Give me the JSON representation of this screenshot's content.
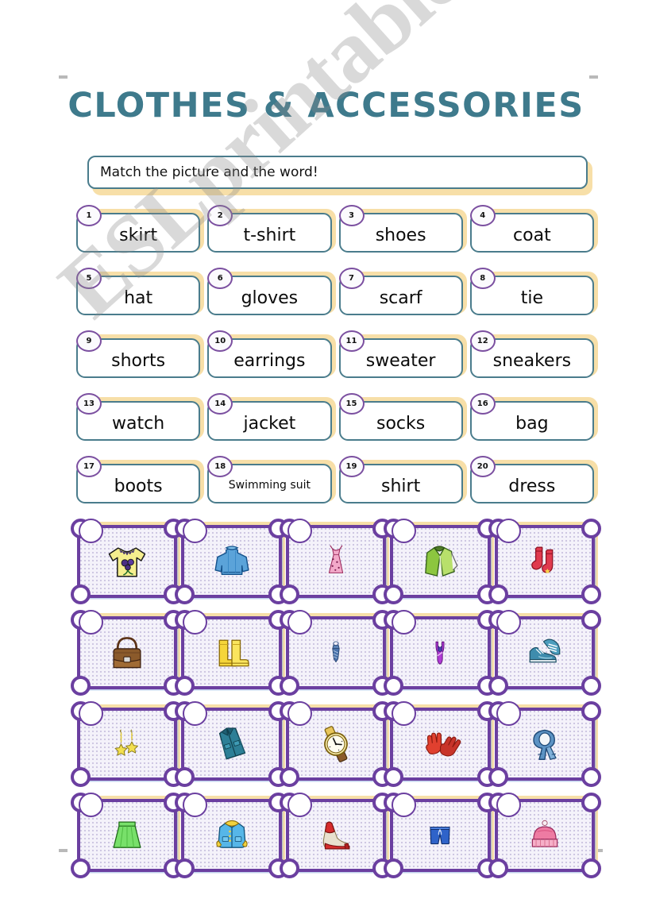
{
  "worksheet": {
    "title": "CLOTHES & ACCESSORIES",
    "instruction": "Match the picture and the word!",
    "watermark": "ESLprintables.com",
    "title_color": "#3E7A8C",
    "box_border_color": "#4A7C8C",
    "number_circle_color": "#7B4FA0",
    "card_border_color": "#6B3FA0",
    "shadow_color": "#F7DFA8"
  },
  "words": [
    {
      "number": "1",
      "label": "skirt"
    },
    {
      "number": "2",
      "label": "t-shirt"
    },
    {
      "number": "3",
      "label": "shoes"
    },
    {
      "number": "4",
      "label": "coat"
    },
    {
      "number": "5",
      "label": "hat"
    },
    {
      "number": "6",
      "label": "gloves"
    },
    {
      "number": "7",
      "label": "scarf"
    },
    {
      "number": "8",
      "label": "tie"
    },
    {
      "number": "9",
      "label": "shorts"
    },
    {
      "number": "10",
      "label": "earrings"
    },
    {
      "number": "11",
      "label": "sweater"
    },
    {
      "number": "12",
      "label": "sneakers"
    },
    {
      "number": "13",
      "label": "watch"
    },
    {
      "number": "14",
      "label": "jacket"
    },
    {
      "number": "15",
      "label": "socks"
    },
    {
      "number": "16",
      "label": "bag"
    },
    {
      "number": "17",
      "label": "boots"
    },
    {
      "number": "18",
      "label": "Swimming suit"
    },
    {
      "number": "19",
      "label": "shirt"
    },
    {
      "number": "20",
      "label": "dress"
    }
  ],
  "pictures": [
    {
      "icon": "tshirt-icon",
      "answer": ""
    },
    {
      "icon": "sweater-icon",
      "answer": ""
    },
    {
      "icon": "dress-icon",
      "answer": ""
    },
    {
      "icon": "shirt-icon",
      "answer": ""
    },
    {
      "icon": "socks-icon",
      "answer": ""
    },
    {
      "icon": "bag-icon",
      "answer": ""
    },
    {
      "icon": "boots-icon",
      "answer": ""
    },
    {
      "icon": "tie-icon",
      "answer": ""
    },
    {
      "icon": "swimming-suit-icon",
      "answer": ""
    },
    {
      "icon": "sneakers-icon",
      "answer": ""
    },
    {
      "icon": "earrings-icon",
      "answer": ""
    },
    {
      "icon": "jacket-icon",
      "answer": ""
    },
    {
      "icon": "watch-icon",
      "answer": ""
    },
    {
      "icon": "gloves-icon",
      "answer": ""
    },
    {
      "icon": "scarf-icon",
      "answer": ""
    },
    {
      "icon": "skirt-icon",
      "answer": ""
    },
    {
      "icon": "coat-icon",
      "answer": ""
    },
    {
      "icon": "shoes-icon",
      "answer": ""
    },
    {
      "icon": "shorts-icon",
      "answer": ""
    },
    {
      "icon": "hat-icon",
      "answer": ""
    }
  ]
}
